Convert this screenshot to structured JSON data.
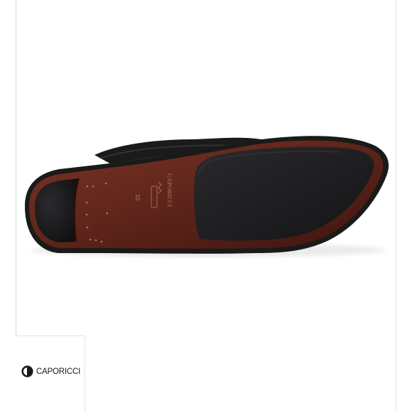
{
  "product_image": {
    "subject": "shoe-sole-photo",
    "brand_stamp": "CAPORICCI",
    "size_stamp": "10"
  },
  "brand_logo": {
    "label": "CAPORICCI",
    "icon": "caporicci-logo-icon"
  },
  "colors": {
    "leather_sole": "#6b2a1f",
    "rubber_pad": "#1f1f22",
    "upper": "#1b1b1b"
  }
}
